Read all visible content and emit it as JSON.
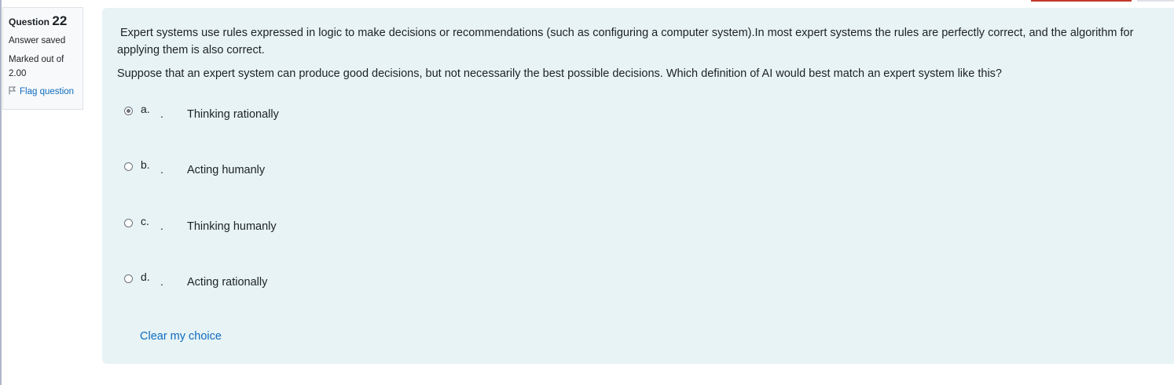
{
  "question": {
    "label": "Question",
    "number": "22",
    "state": "Answer saved",
    "grade_line1": "Marked out of",
    "grade_line2": "2.00",
    "flag_label": "Flag question"
  },
  "text": {
    "paragraph1": "Expert systems use rules expressed in logic to make decisions or recommendations (such as configuring a computer system).In most expert systems the rules are perfectly correct, and the algorithm for applying them is also correct.",
    "paragraph2": "Suppose that an expert system can produce good decisions, but not necessarily the best possible decisions. Which definition of AI would best match an expert system like this?"
  },
  "options": [
    {
      "letter": "a.",
      "dot": ".",
      "text": "Thinking rationally",
      "selected": true
    },
    {
      "letter": "b.",
      "dot": ".",
      "text": "Acting humanly",
      "selected": false
    },
    {
      "letter": "c.",
      "dot": ".",
      "text": "Thinking humanly",
      "selected": false
    },
    {
      "letter": "d.",
      "dot": ".",
      "text": "Acting rationally",
      "selected": false
    }
  ],
  "clear_label": "Clear my choice",
  "colors": {
    "background": "#e7f3f5",
    "link": "#0f6cbf",
    "info_bg": "#f8f9fa"
  }
}
